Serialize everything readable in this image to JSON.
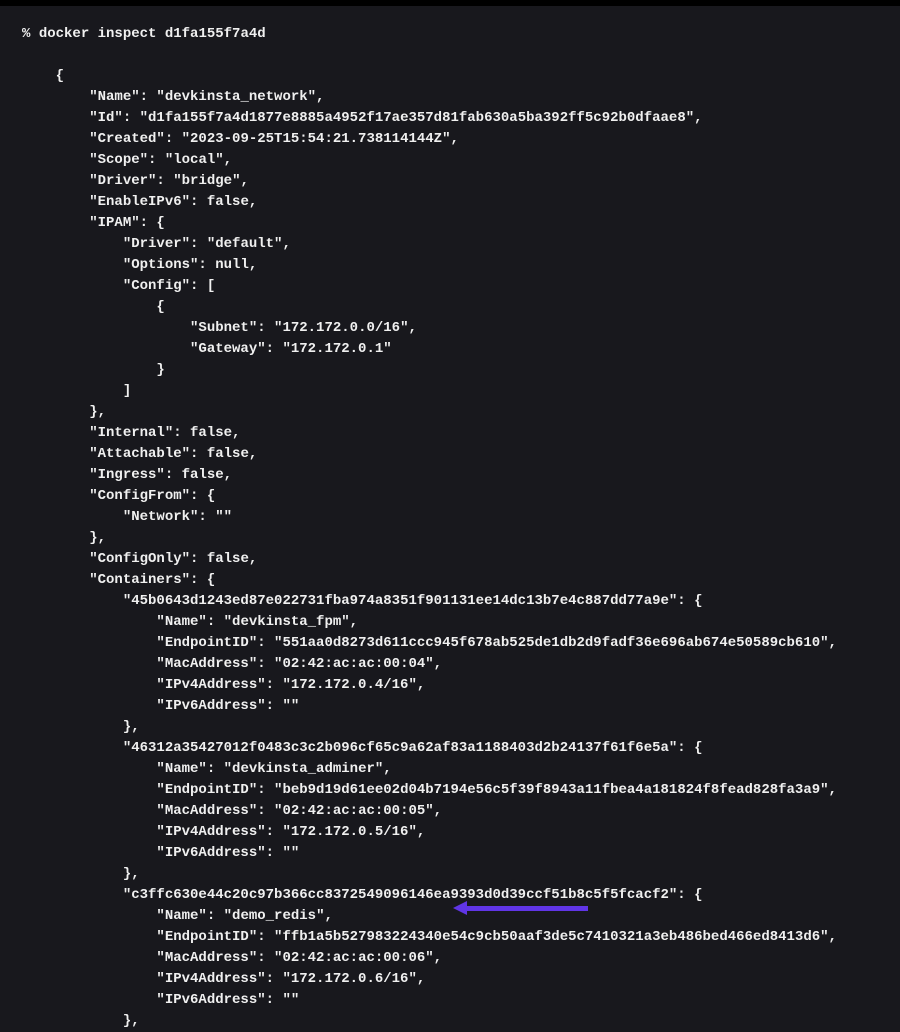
{
  "prompt": "% ",
  "command": "docker inspect d1fa155f7a4d",
  "output": {
    "Name": "devkinsta_network",
    "Id": "d1fa155f7a4d1877e8885a4952f17ae357d81fab630a5ba392ff5c92b0dfaae8",
    "Created": "2023-09-25T15:54:21.738114144Z",
    "Scope": "local",
    "Driver": "bridge",
    "EnableIPv6": "false",
    "IPAM": {
      "Driver": "default",
      "Options": "null",
      "Config": {
        "Subnet": "172.172.0.0/16",
        "Gateway": "172.172.0.1"
      }
    },
    "Internal": "false",
    "Attachable": "false",
    "Ingress": "false",
    "ConfigFrom": {
      "Network": ""
    },
    "ConfigOnly": "false",
    "Containers": {
      "c1": {
        "key": "45b0643d1243ed87e022731fba974a8351f901131ee14dc13b7e4c887dd77a9e",
        "Name": "devkinsta_fpm",
        "EndpointID": "551aa0d8273d611ccc945f678ab525de1db2d9fadf36e696ab674e50589cb610",
        "MacAddress": "02:42:ac:ac:00:04",
        "IPv4Address": "172.172.0.4/16",
        "IPv6Address": ""
      },
      "c2": {
        "key": "46312a35427012f0483c3c2b096cf65c9a62af83a1188403d2b24137f61f6e5a",
        "Name": "devkinsta_adminer",
        "EndpointID": "beb9d19d61ee02d04b7194e56c5f39f8943a11fbea4a181824f8fead828fa3a9",
        "MacAddress": "02:42:ac:ac:00:05",
        "IPv4Address": "172.172.0.5/16",
        "IPv6Address": ""
      },
      "c3": {
        "key": "c3ffc630e44c20c97b366cc8372549096146ea9393d0d39ccf51b8c5f5fcacf2",
        "Name": "demo_redis",
        "EndpointID": "ffb1a5b527983224340e54c9cb50aaf3de5c7410321a3eb486bed466ed8413d6",
        "MacAddress": "02:42:ac:ac:00:06",
        "IPv4Address": "172.172.0.6/16",
        "IPv6Address": ""
      }
    }
  }
}
